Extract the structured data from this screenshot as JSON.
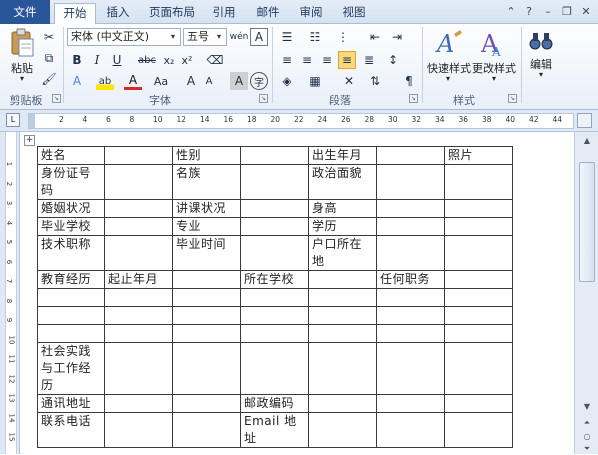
{
  "tabs": {
    "file": "文件",
    "items": [
      "开始",
      "插入",
      "页面布局",
      "引用",
      "邮件",
      "审阅",
      "视图"
    ]
  },
  "ribbon": {
    "clipboard": {
      "paste_label": "粘贴",
      "group_label": "剪贴板"
    },
    "font": {
      "font_name": "宋体 (中文正文)",
      "font_size": "五号",
      "group_label": "字体"
    },
    "paragraph": {
      "group_label": "段落"
    },
    "styles": {
      "quick_styles_label": "快速样式",
      "change_styles_label": "更改样式",
      "group_label": "样式"
    },
    "editing": {
      "label": "编辑"
    }
  },
  "ruler": {
    "numbers": [
      "2",
      "4",
      "6",
      "8",
      "10",
      "12",
      "14",
      "16",
      "18",
      "20",
      "22",
      "24",
      "26",
      "28",
      "30",
      "32",
      "34",
      "36",
      "38",
      "40",
      "42",
      "44"
    ],
    "vertical_numbers": [
      "1",
      "2",
      "3",
      "4",
      "5",
      "6",
      "7",
      "8",
      "9",
      "10",
      "11",
      "12",
      "13",
      "14",
      "15"
    ]
  },
  "table": {
    "rows": [
      [
        "姓名",
        "",
        "性别",
        "",
        "出生年月",
        "",
        "照片"
      ],
      [
        "身份证号码",
        "",
        "名族",
        "",
        "政治面貌",
        "",
        ""
      ],
      [
        "婚姻状况",
        "",
        "讲课状况",
        "",
        "身高",
        "",
        ""
      ],
      [
        "毕业学校",
        "",
        "专业",
        "",
        "学历",
        "",
        ""
      ],
      [
        "技术职称",
        "",
        "毕业时间",
        "",
        "户口所在地",
        "",
        ""
      ],
      [
        "教育经历",
        "起止年月",
        "",
        "所在学校",
        "",
        "任何职务",
        ""
      ],
      [
        "",
        "",
        "",
        "",
        "",
        "",
        ""
      ],
      [
        "",
        "",
        "",
        "",
        "",
        "",
        ""
      ],
      [
        "",
        "",
        "",
        "",
        "",
        "",
        ""
      ],
      [
        "社会实践与工作经历",
        "",
        "",
        "",
        "",
        "",
        ""
      ],
      [
        "通讯地址",
        "",
        "",
        "邮政编码",
        "",
        "",
        ""
      ],
      [
        "联系电话",
        "",
        "",
        "Email 地址",
        "",
        "",
        ""
      ]
    ]
  }
}
